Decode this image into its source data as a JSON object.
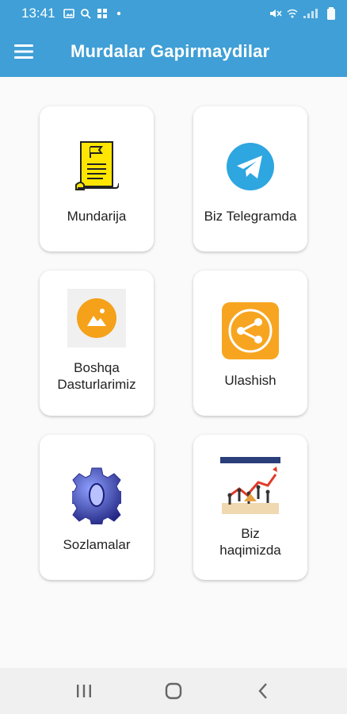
{
  "status_bar": {
    "time": "13:41",
    "left_icons": [
      "image-icon",
      "search-icon",
      "grid-icon",
      "dot-icon"
    ],
    "right_icons": [
      "mute-icon",
      "wifi-icon",
      "signal-icon",
      "battery-icon"
    ]
  },
  "app_bar": {
    "title": "Murdalar Gapirmaydilar",
    "menu_icon": "hamburger-menu-icon",
    "background": "#3f9fd6"
  },
  "menu_items": [
    {
      "label": "Mundarija",
      "icon": "scroll-flag-icon"
    },
    {
      "label": "Biz Telegramda",
      "icon": "telegram-icon"
    },
    {
      "label": "Boshqa\nDasturlarimiz",
      "icon": "apps-photo-icon"
    },
    {
      "label": "Ulashish",
      "icon": "share-icon"
    },
    {
      "label": "Sozlamalar",
      "icon": "settings-gear-icon"
    },
    {
      "label": "Biz\nhaqimizda",
      "icon": "business-growth-icon"
    }
  ],
  "nav_bar": {
    "buttons": [
      "recent-apps-icon",
      "home-icon",
      "back-icon"
    ]
  }
}
